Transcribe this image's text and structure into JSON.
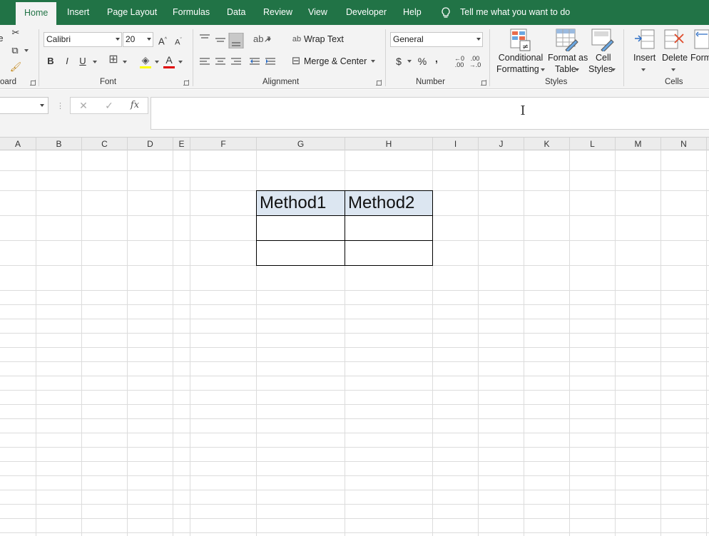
{
  "tabs": {
    "home": "Home",
    "insert": "Insert",
    "page_layout": "Page Layout",
    "formulas": "Formulas",
    "data": "Data",
    "review": "Review",
    "view": "View",
    "developer": "Developer",
    "help": "Help",
    "tell_me": "Tell me what you want to do"
  },
  "clipboard": {
    "label": "oard"
  },
  "font": {
    "name": "Calibri",
    "size": "20",
    "label": "Font",
    "bold": "B",
    "italic": "I",
    "underline": "U"
  },
  "alignment": {
    "wrap_text": "Wrap Text",
    "merge_center": "Merge & Center",
    "label": "Alignment"
  },
  "number": {
    "format": "General",
    "currency": "$",
    "percent": "%",
    "comma": ",",
    "label": "Number"
  },
  "styles": {
    "conditional_formatting": [
      "Conditional",
      "Formatting"
    ],
    "format_as_table": [
      "Format as",
      "Table"
    ],
    "cell_styles": [
      "Cell",
      "Styles"
    ],
    "label": "Styles"
  },
  "cells": {
    "insert": "Insert",
    "delete": "Delete",
    "format": "Form",
    "label": "Cells"
  },
  "formula_bar": {
    "fx": "fx",
    "value": ""
  },
  "columns": [
    "A",
    "B",
    "C",
    "D",
    "E",
    "F",
    "G",
    "H",
    "I",
    "J",
    "K",
    "L",
    "M",
    "N"
  ],
  "table": {
    "header": [
      "Method1",
      "Method2"
    ],
    "rows": [
      [
        "",
        ""
      ],
      [
        "",
        ""
      ]
    ],
    "header_fill": "#dce6f1"
  },
  "colors": {
    "brand": "#217346",
    "font_color": "#e00000"
  }
}
